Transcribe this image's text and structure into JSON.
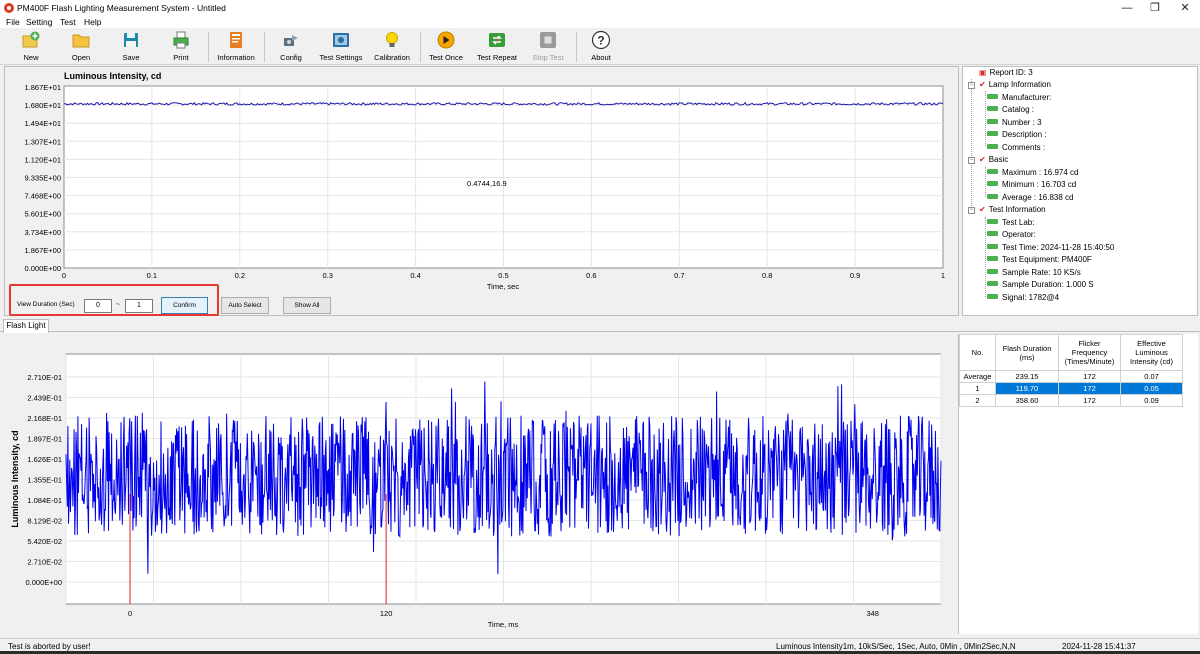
{
  "window": {
    "title": "PM400F Flash Lighting Measurement System - Untitled",
    "controls": [
      "—",
      "❐",
      "✕"
    ]
  },
  "menu": [
    "File",
    "Setting",
    "Test",
    "Help"
  ],
  "toolbar": [
    {
      "label": "New",
      "icon": "new-icon"
    },
    {
      "label": "Open",
      "icon": "open-folder-icon"
    },
    {
      "label": "Save",
      "icon": "save-icon"
    },
    {
      "label": "Print",
      "icon": "print-icon"
    },
    {
      "label": "Information",
      "icon": "information-icon"
    },
    {
      "label": "Config",
      "icon": "config-icon"
    },
    {
      "label": "Test Settings",
      "icon": "test-settings-icon"
    },
    {
      "label": "Calibration",
      "icon": "calibration-bulb-icon"
    },
    {
      "label": "Test Once",
      "icon": "test-once-icon"
    },
    {
      "label": "Test Repeat",
      "icon": "test-repeat-icon"
    },
    {
      "label": "Stop Test",
      "icon": "stop-test-icon",
      "disabled": true
    },
    {
      "label": "About",
      "icon": "about-help-icon"
    }
  ],
  "top_chart": {
    "title": "Luminous Intensity, cd",
    "xlabel": "Time, sec",
    "y_ticks": [
      "1.867E+01",
      "1.680E+01",
      "1.494E+01",
      "1.307E+01",
      "1.120E+01",
      "9.335E+00",
      "7.468E+00",
      "5.601E+00",
      "3.734E+00",
      "1.867E+00",
      "0.000E+00"
    ],
    "x_ticks": [
      "0",
      "0.1",
      "0.2",
      "0.3",
      "0.4",
      "0.5",
      "0.6",
      "0.7",
      "0.8",
      "0.9",
      "1"
    ],
    "annotation": "0.4744,16.9",
    "line_color": "#1a1aa8"
  },
  "controls": {
    "view_duration_label": "View Duration (Sec)",
    "from_value": "0",
    "separator": "~",
    "to_value": "1",
    "confirm_label": "Confirm",
    "auto_select_label": "Auto Select",
    "show_all_label": "Show All"
  },
  "tree": {
    "report": "Report ID: 3",
    "lamp_info": {
      "label": "Lamp Information",
      "items": [
        "Manufacturer:",
        "Catalog    :",
        "Number     : 3",
        "Description :",
        "Comments    :"
      ]
    },
    "basic": {
      "label": "Basic",
      "items": [
        "Maximum  : 16.974 cd",
        "Minimum  : 16.703 cd",
        "Average  : 16.838 cd"
      ]
    },
    "test_info": {
      "label": "Test Information",
      "items": [
        "Test Lab:",
        "Operator:",
        "Test Time: 2024-11-28 15:40:50",
        "Test Equipment: PM400F",
        "Sample Rate: 10 KS/s",
        "Sample Duration: 1.000 S",
        "Signal: 1782@4"
      ]
    }
  },
  "tab": "Flash Light",
  "bottom_chart": {
    "ylabel": "Luminous Intensity, cd",
    "xlabel": "Time, ms",
    "y_ticks": [
      "2.710E-01",
      "2.439E-01",
      "2.168E-01",
      "1.897E-01",
      "1.626E-01",
      "1.355E-01",
      "1.084E-01",
      "8.129E-02",
      "5.420E-02",
      "2.710E-02",
      "0.000E+00"
    ],
    "x_ticks": [
      "0",
      "120",
      "348"
    ],
    "line_color": "#0000ee",
    "marker_color": "#e02020"
  },
  "table": {
    "headers": [
      "No.",
      "Flash Duration (ms)",
      "Flicker Frequency (Times/Minute)",
      "Effective Luminous Intensity (cd)"
    ],
    "rows": [
      [
        "Average",
        "239.15",
        "172",
        "0.07"
      ],
      [
        "1",
        "119.70",
        "172",
        "0.05"
      ],
      [
        "2",
        "358.60",
        "172",
        "0.09"
      ]
    ]
  },
  "status": {
    "left": "Test is aborted by user!",
    "middle": "Luminous Intensity1m, 10kS/Sec, 1Sec,  Auto, 0Min , 0Min2Sec,N,N",
    "right": "2024-11-28 15:41:37"
  }
}
